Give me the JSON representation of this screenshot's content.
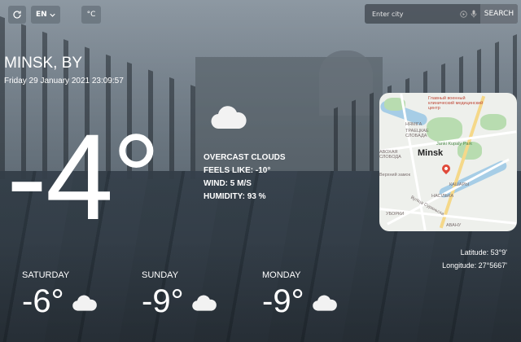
{
  "controls": {
    "lang": "EN",
    "unit": "°C"
  },
  "search": {
    "placeholder": "Enter city",
    "button": "SEARCH"
  },
  "location": {
    "city": "MINSK, BY",
    "datetime": "Friday 29 January 2021 23:09:57"
  },
  "current": {
    "temperature": "-4°",
    "icon": "cloud-icon",
    "description": "OVERCAST CLOUDS",
    "feels_like": "FEELS LIKE: -10°",
    "wind": "WIND: 5 M/S",
    "humidity": "HUMIDITY: 93 %"
  },
  "map": {
    "city_label": "Minsk",
    "labels": {
      "hospital": "Главный военный клинический медицинский центр",
      "nemiga": "НЯМІГА",
      "slabada": "ТРАЕЦКАЕ СЛОБАДА",
      "park": "Janki Kupaly Park",
      "alejnaya": "АВОХАЯ СЛОБОДА",
      "castle": "Верхний замок",
      "kashary": "КАШАРЫ",
      "nyasinka": "НАСІЛЬКА",
      "uborki": "УБОРКИ",
      "street": "Вуліца Сураньска",
      "avany": "АВАНУ"
    }
  },
  "coords": {
    "latitude": "Latitude: 53°9'",
    "longitude": "Longitude: 27°5667'"
  },
  "forecast": [
    {
      "day": "SATURDAY",
      "temp": "-6°",
      "icon": "cloud-icon"
    },
    {
      "day": "SUNDAY",
      "temp": "-9°",
      "icon": "cloud-icon"
    },
    {
      "day": "MONDAY",
      "temp": "-9°",
      "icon": "cloud-icon"
    }
  ]
}
